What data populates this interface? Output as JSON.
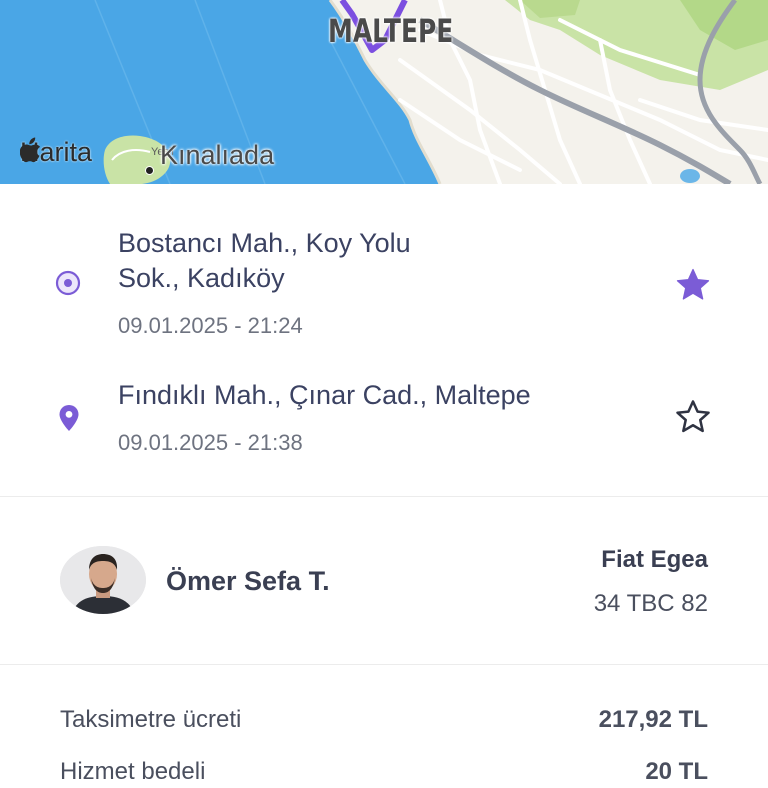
{
  "map": {
    "district_label": "MALTEPE",
    "island_label": "Kınalıada",
    "island_sub_label": "Yeşil",
    "attribution": "Harita",
    "attribution_icon": "apple-logo-icon"
  },
  "trip": {
    "pickup": {
      "address_line1": "Bostancı Mah., Koy Yolu",
      "address_line2": "Sok., Kadıköy",
      "time": "09.01.2025 - 21:24",
      "favorite": true,
      "marker_icon": "pickup-dot-icon"
    },
    "dropoff": {
      "address_line1": "Fındıklı Mah., Çınar Cad., Maltepe",
      "time": "09.01.2025 - 21:38",
      "favorite": false,
      "marker_icon": "location-pin-icon"
    }
  },
  "driver": {
    "name": "Ömer Sefa T.",
    "car_model": "Fiat Egea",
    "plate": "34 TBC 82"
  },
  "fare": {
    "rows": [
      {
        "label": "Taksimetre ücreti",
        "value": "217,92 TL"
      },
      {
        "label": "Hizmet bedeli",
        "value": "20 TL"
      }
    ]
  },
  "colors": {
    "accent": "#7b5cd6",
    "sea": "#4aa6e6",
    "land": "#f4f2ec",
    "park": "#c9e3a6",
    "route": "#7c4fe0"
  }
}
